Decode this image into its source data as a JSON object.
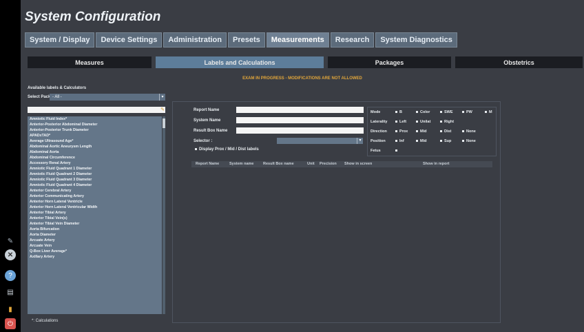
{
  "header": {
    "title": "System Configuration"
  },
  "tabs": [
    {
      "label": "System / Display"
    },
    {
      "label": "Device Settings"
    },
    {
      "label": "Administration"
    },
    {
      "label": "Presets"
    },
    {
      "label": "Measurements"
    },
    {
      "label": "Research"
    },
    {
      "label": "System Diagnostics"
    }
  ],
  "subtabs": [
    {
      "label": "Measures"
    },
    {
      "label": "Labels and Calculations"
    },
    {
      "label": "Packages"
    },
    {
      "label": "Obstetrics"
    }
  ],
  "warning": "EXAM IN PROGRESS - MODIFICATIONS ARE NOT ALLOWED",
  "left": {
    "available_label": "Available labels & Calculators",
    "select_package_label": "Select Package",
    "select_package_value": "- All -",
    "search_value": "",
    "items": [
      "Amniotic Fluid Index*",
      "Anterior-Posterior Abdominal Diameter",
      "Anterior-Posterior Trunk Diameter",
      "APADxTAD*",
      "Average Ultrasound Age*",
      "Abdominal Aortic Aneurysm Length",
      "Abdominal Aorta",
      "Abdominal Circumference",
      "Accessory Renal Artery",
      "Amniotic Fluid Quadrant 1 Diameter",
      "Amniotic Fluid Quadrant 2 Diameter",
      "Amniotic Fluid Quadrant 3 Diameter",
      "Amniotic Fluid Quadrant 4 Diameter",
      "Anterior Cerebral Artery",
      "Anterior Communicating Artery",
      "Anterior Horn Lateral Ventricle",
      "Anterior Horn Lateral Ventricular Width",
      "Anterior Tibial Artery",
      "Anterior Tibial Vein(s)",
      "Anterior Tibial Vein Diameter",
      "Aorta Bifurcation",
      "Aorta Diameter",
      "Arcuate Artery",
      "Arcuate Vein",
      "Q-Box Liver Average*",
      "Axillary Artery"
    ],
    "footnote": "*: Calculations"
  },
  "form": {
    "report_name_label": "Report Name",
    "system_name_label": "System Name",
    "result_box_name_label": "Result Box Name",
    "selector_label": "Selector :",
    "display_prox_label": "Display Prox / Mid / Dist labels",
    "report_name_value": "",
    "system_name_value": "",
    "result_box_name_value": ""
  },
  "grid": {
    "mode": {
      "label": "Mode",
      "options": [
        "B",
        "Color",
        "SWE",
        "PW",
        "M"
      ]
    },
    "laterality": {
      "label": "Laterality",
      "options": [
        "Left",
        "Unilat",
        "Right"
      ]
    },
    "direction": {
      "label": "Direction",
      "options": [
        "Prox",
        "Mid",
        "Dist",
        "None"
      ]
    },
    "position": {
      "label": "Position",
      "options": [
        "Inf",
        "Mid",
        "Sup",
        "None"
      ]
    },
    "fetus": {
      "label": "Fetus"
    }
  },
  "table": {
    "headers": [
      "Report Name",
      "System name",
      "Result Box name",
      "Unit",
      "Precision",
      "Show in screen",
      "Show in report"
    ]
  },
  "sidebar_icons": [
    "probe-icon",
    "cancel-icon",
    "help-icon",
    "printer-icon",
    "battery-icon",
    "power-icon"
  ],
  "colors": {
    "accent": "#5d7d9a",
    "warning": "#e2a63a"
  }
}
